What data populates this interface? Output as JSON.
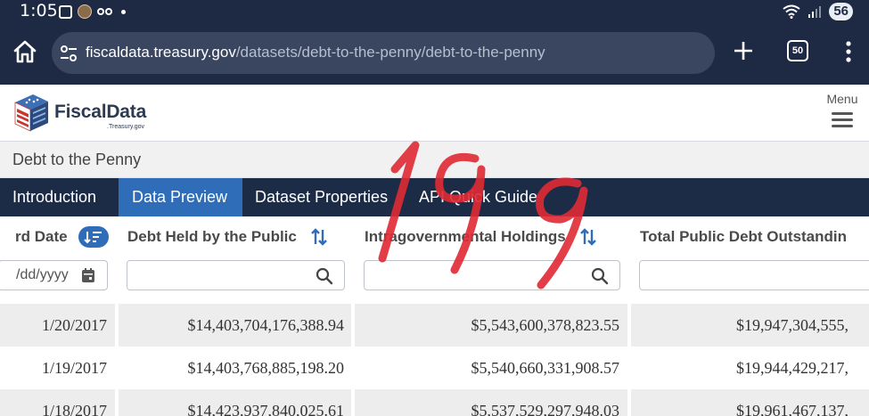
{
  "status_bar": {
    "time": "1:05",
    "battery": "56"
  },
  "browser": {
    "url_host": "fiscaldata.treasury.gov",
    "url_path": "/datasets/debt-to-the-penny/debt-to-the-penny",
    "tab_count": "50"
  },
  "site": {
    "logo_text": "FiscalData",
    "logo_sub": ".Treasury.gov",
    "menu_label": "Menu"
  },
  "breadcrumb": "Debt to the Penny",
  "tabs": [
    {
      "label": "Introduction",
      "active": false
    },
    {
      "label": "Data Preview",
      "active": true
    },
    {
      "label": "Dataset Properties",
      "active": false
    },
    {
      "label": "API Quick Guide",
      "active": false
    }
  ],
  "table": {
    "columns": [
      {
        "header": "rd Date"
      },
      {
        "header": "Debt Held by the Public"
      },
      {
        "header": "Intragovernmental Holdings"
      },
      {
        "header": "Total Public Debt Outstandin"
      }
    ],
    "date_placeholder": "/dd/yyyy",
    "rows": [
      {
        "date": "1/20/2017",
        "public": "$14,403,704,176,388.94",
        "intragov": "$5,543,600,378,823.55",
        "total": "$19,947,304,555,"
      },
      {
        "date": "1/19/2017",
        "public": "$14,403,768,885,198.20",
        "intragov": "$5,540,660,331,908.57",
        "total": "$19,944,429,217,"
      },
      {
        "date": "1/18/2017",
        "public": "$14,423,937,840,025.61",
        "intragov": "$5,537,529,297,948.03",
        "total": "$19,961,467,137,"
      }
    ]
  },
  "colors": {
    "chrome_bg": "#1e2a44",
    "tab_bar_bg": "#1c2c47",
    "active_tab_bg": "#2f6db8",
    "sort_icon": "#2f6db8",
    "scribble": "#e02a34"
  }
}
